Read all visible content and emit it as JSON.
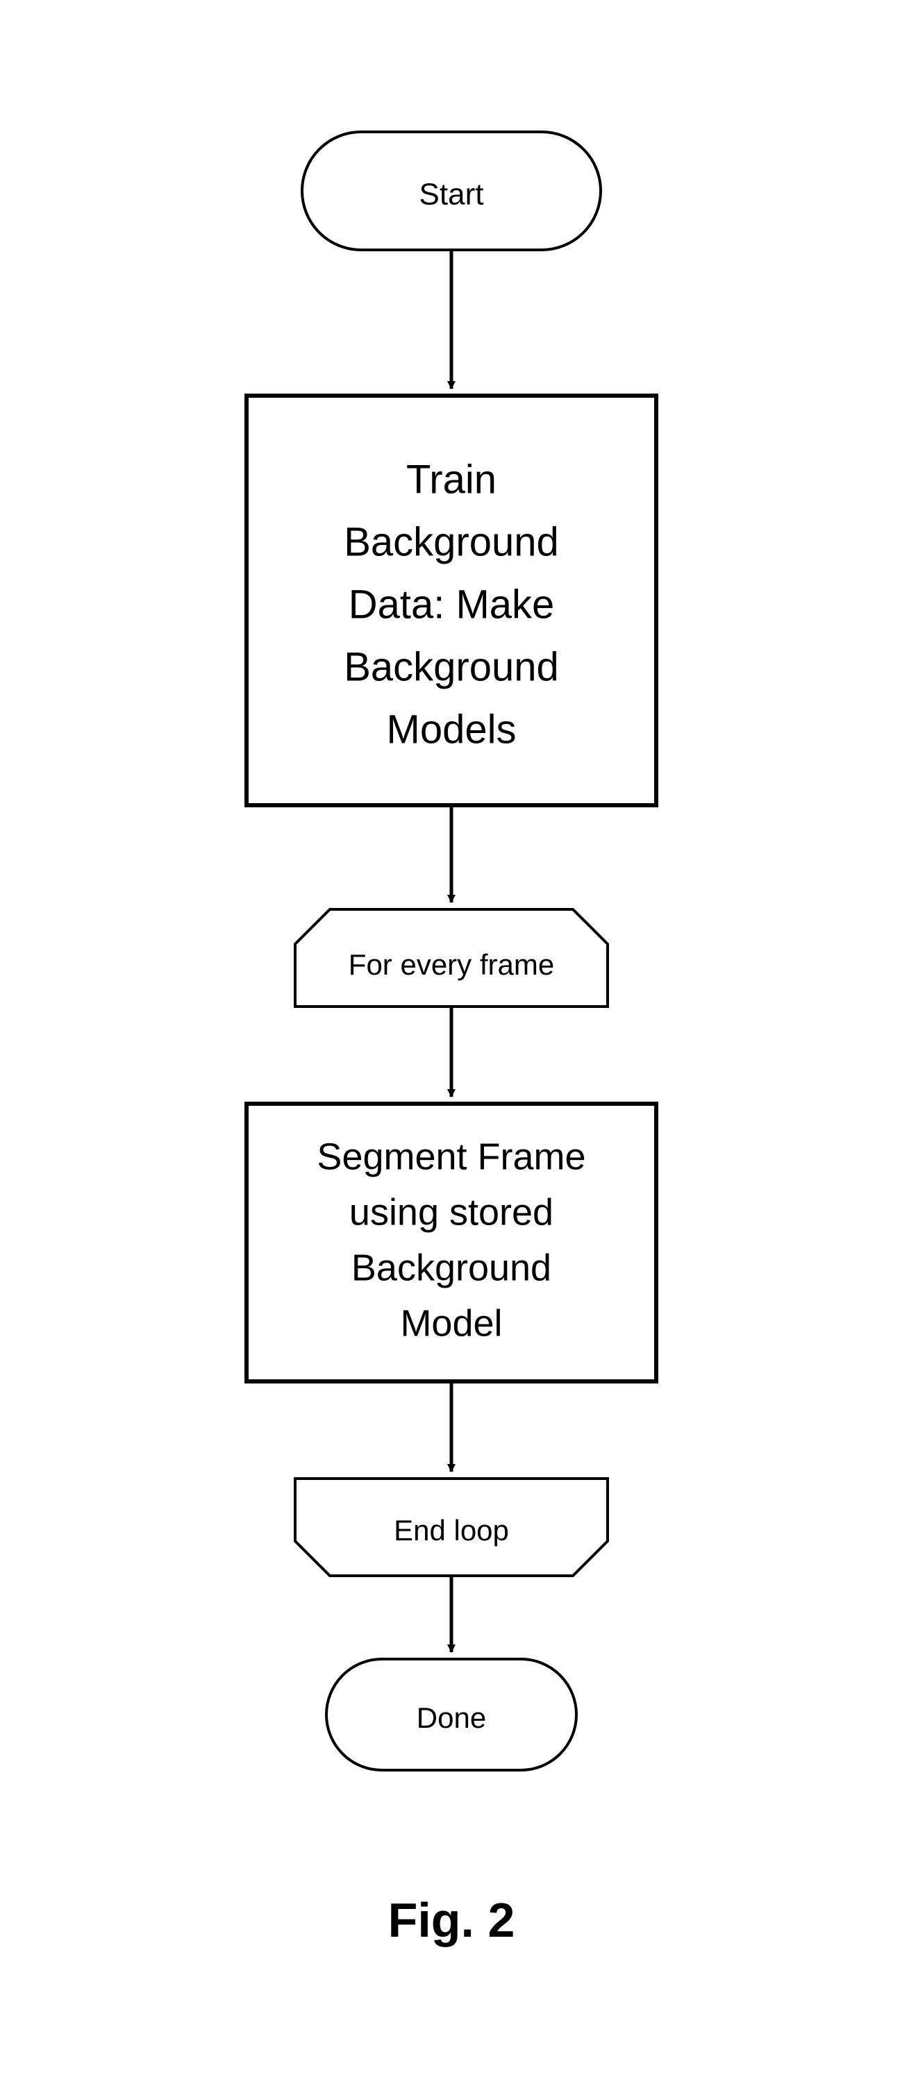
{
  "chart_data": {
    "type": "flowchart",
    "title": "Fig. 2",
    "nodes": [
      {
        "id": "start",
        "shape": "terminator",
        "label": "Start"
      },
      {
        "id": "train",
        "shape": "process",
        "label": "Train Background Data: Make Background Models"
      },
      {
        "id": "loopStart",
        "shape": "loop-start",
        "label": "For every frame"
      },
      {
        "id": "segment",
        "shape": "process",
        "label": "Segment Frame using stored Background Model"
      },
      {
        "id": "loopEnd",
        "shape": "loop-end",
        "label": "End loop"
      },
      {
        "id": "done",
        "shape": "terminator",
        "label": "Done"
      }
    ],
    "edges": [
      {
        "from": "start",
        "to": "train"
      },
      {
        "from": "train",
        "to": "loopStart"
      },
      {
        "from": "loopStart",
        "to": "segment"
      },
      {
        "from": "segment",
        "to": "loopEnd"
      },
      {
        "from": "loopEnd",
        "to": "done"
      }
    ]
  },
  "nodes": {
    "start": {
      "label": "Start"
    },
    "train": {
      "l1": "Train",
      "l2": "Background",
      "l3": "Data: Make",
      "l4": "Background",
      "l5": "Models"
    },
    "loopStart": {
      "label": "For every frame"
    },
    "segment": {
      "l1": "Segment Frame",
      "l2": "using stored",
      "l3": "Background",
      "l4": "Model"
    },
    "loopEnd": {
      "label": "End loop"
    },
    "done": {
      "label": "Done"
    }
  },
  "caption": "Fig. 2"
}
